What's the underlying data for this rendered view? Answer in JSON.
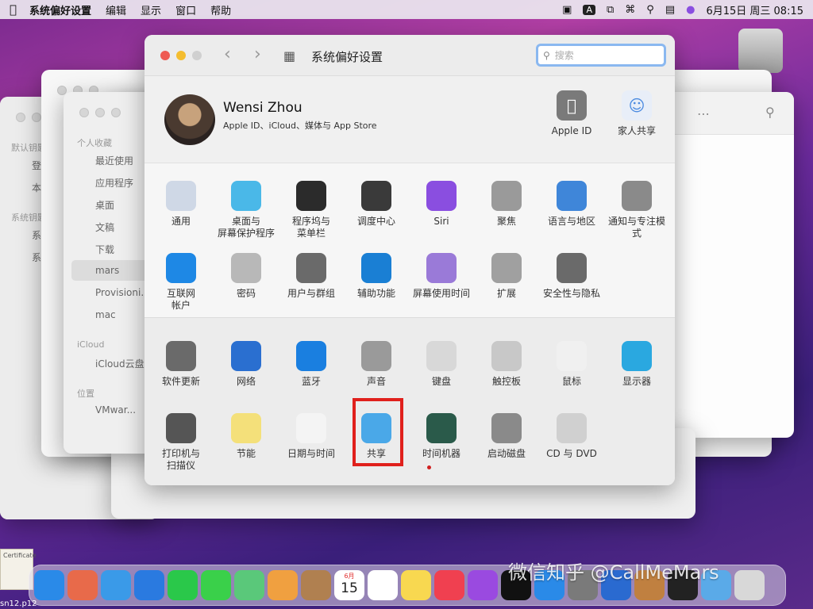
{
  "menubar": {
    "app": "系统偏好设置",
    "items": [
      "编辑",
      "显示",
      "窗口",
      "帮助"
    ],
    "datetime": "6月15日 周三 08:15",
    "input_label": "A"
  },
  "window": {
    "title": "系统偏好设置",
    "search_placeholder": "搜索"
  },
  "account": {
    "name": "Wensi Zhou",
    "subtitle": "Apple ID、iCloud、媒体与 App Store",
    "apple_id": "Apple ID",
    "family": "家人共享"
  },
  "row1": [
    {
      "label": "通用",
      "icon": "general-icon",
      "color": "#cfd8e6"
    },
    {
      "label": "桌面与\n屏幕保护程序",
      "icon": "desktop-icon",
      "color": "#4ab8e8"
    },
    {
      "label": "程序坞与\n菜单栏",
      "icon": "dock-icon",
      "color": "#2b2b2b"
    },
    {
      "label": "调度中心",
      "icon": "mission-control-icon",
      "color": "#3a3a3a"
    },
    {
      "label": "Siri",
      "icon": "siri-icon",
      "color": "#8a4ee0"
    },
    {
      "label": "聚焦",
      "icon": "spotlight-icon",
      "color": "#9a9a9a"
    },
    {
      "label": "语言与地区",
      "icon": "language-icon",
      "color": "#3f86d9"
    },
    {
      "label": "通知与专注模式",
      "icon": "notification-icon",
      "color": "#8a8a8a"
    }
  ],
  "row2": [
    {
      "label": "互联网\n帐户",
      "icon": "internet-accounts-icon",
      "color": "#1e88e5"
    },
    {
      "label": "密码",
      "icon": "key-icon",
      "color": "#b8b8b8"
    },
    {
      "label": "用户与群组",
      "icon": "users-icon",
      "color": "#6a6a6a"
    },
    {
      "label": "辅助功能",
      "icon": "accessibility-icon",
      "color": "#1a7fd4"
    },
    {
      "label": "屏幕使用时间",
      "icon": "hourglass-icon",
      "color": "#9a7ad8"
    },
    {
      "label": "扩展",
      "icon": "extensions-icon",
      "color": "#a0a0a0"
    },
    {
      "label": "安全性与隐私",
      "icon": "security-icon",
      "color": "#6a6a6a"
    }
  ],
  "row3": [
    {
      "label": "软件更新",
      "icon": "software-update-icon",
      "color": "#6a6a6a"
    },
    {
      "label": "网络",
      "icon": "network-icon",
      "color": "#2a6fd0"
    },
    {
      "label": "蓝牙",
      "icon": "bluetooth-icon",
      "color": "#1a7fe0"
    },
    {
      "label": "声音",
      "icon": "sound-icon",
      "color": "#9a9a9a"
    },
    {
      "label": "键盘",
      "icon": "keyboard-icon",
      "color": "#d8d8d8"
    },
    {
      "label": "触控板",
      "icon": "trackpad-icon",
      "color": "#c8c8c8"
    },
    {
      "label": "鼠标",
      "icon": "mouse-icon",
      "color": "#f0f0f0"
    },
    {
      "label": "显示器",
      "icon": "display-icon",
      "color": "#2aa8e0"
    }
  ],
  "row4": [
    {
      "label": "打印机与\n扫描仪",
      "icon": "printer-icon",
      "color": "#555555"
    },
    {
      "label": "节能",
      "icon": "energy-saver-icon",
      "color": "#f4e07a"
    },
    {
      "label": "日期与时间",
      "icon": "clock-icon",
      "color": "#f4f4f4"
    },
    {
      "label": "共享",
      "icon": "sharing-icon",
      "color": "#4aa8e8"
    },
    {
      "label": "时间机器",
      "icon": "time-machine-icon",
      "color": "#2a5a4a"
    },
    {
      "label": "启动磁盘",
      "icon": "startup-disk-icon",
      "color": "#8a8a8a"
    },
    {
      "label": "CD 与 DVD",
      "icon": "cd-dvd-icon",
      "color": "#d0d0d0"
    }
  ],
  "finder1": {
    "sections": [
      "默认钥匙",
      "系统钥匙"
    ],
    "items": [
      "登",
      "本",
      "系",
      "系"
    ]
  },
  "finder2": {
    "favorites_header": "个人收藏",
    "favorites": [
      "最近使用",
      "应用程序",
      "桌面",
      "文稿",
      "下载",
      "mars",
      "Provisioni...",
      "mac"
    ],
    "icloud_header": "iCloud",
    "icloud": [
      "iCloud云盘"
    ],
    "location_header": "位置",
    "locations": [
      "VMwar..."
    ]
  },
  "dock": {
    "apps": [
      {
        "name": "finder-icon",
        "color": "#2a8ae8"
      },
      {
        "name": "launchpad-icon",
        "color": "#e86a4a"
      },
      {
        "name": "safari-icon",
        "color": "#3a9ae8"
      },
      {
        "name": "mail-icon",
        "color": "#2a7ae0"
      },
      {
        "name": "facetime-icon",
        "color": "#2ac84a"
      },
      {
        "name": "messages-icon",
        "color": "#3ad04a"
      },
      {
        "name": "maps-icon",
        "color": "#5ac87a"
      },
      {
        "name": "photos-icon",
        "color": "#f0a040"
      },
      {
        "name": "contacts-icon",
        "color": "#b08050"
      },
      {
        "name": "calendar-icon",
        "color": "#ffffff"
      },
      {
        "name": "reminders-icon",
        "color": "#ffffff"
      },
      {
        "name": "notes-icon",
        "color": "#f8d850"
      },
      {
        "name": "music-icon",
        "color": "#f04050"
      },
      {
        "name": "podcasts-icon",
        "color": "#9a4ae0"
      },
      {
        "name": "appletv-icon",
        "color": "#111111"
      },
      {
        "name": "appstore-icon",
        "color": "#2a8ae8"
      },
      {
        "name": "system-preferences-icon",
        "color": "#7a7a7a"
      },
      {
        "name": "xcode-icon",
        "color": "#2a6ad0"
      },
      {
        "name": "preview-icon",
        "color": "#c08040"
      },
      {
        "name": "terminal-icon",
        "color": "#222222"
      },
      {
        "name": "downloads-folder-icon",
        "color": "#5aaae8"
      },
      {
        "name": "trash-icon",
        "color": "#d8d8d8"
      }
    ],
    "calendar_month": "6月",
    "calendar_day": "15"
  },
  "desktop": {
    "watermark": "微信知乎 @CallMeMars",
    "bottom_label": "sn12.p12",
    "cert_text": "Certificate"
  }
}
